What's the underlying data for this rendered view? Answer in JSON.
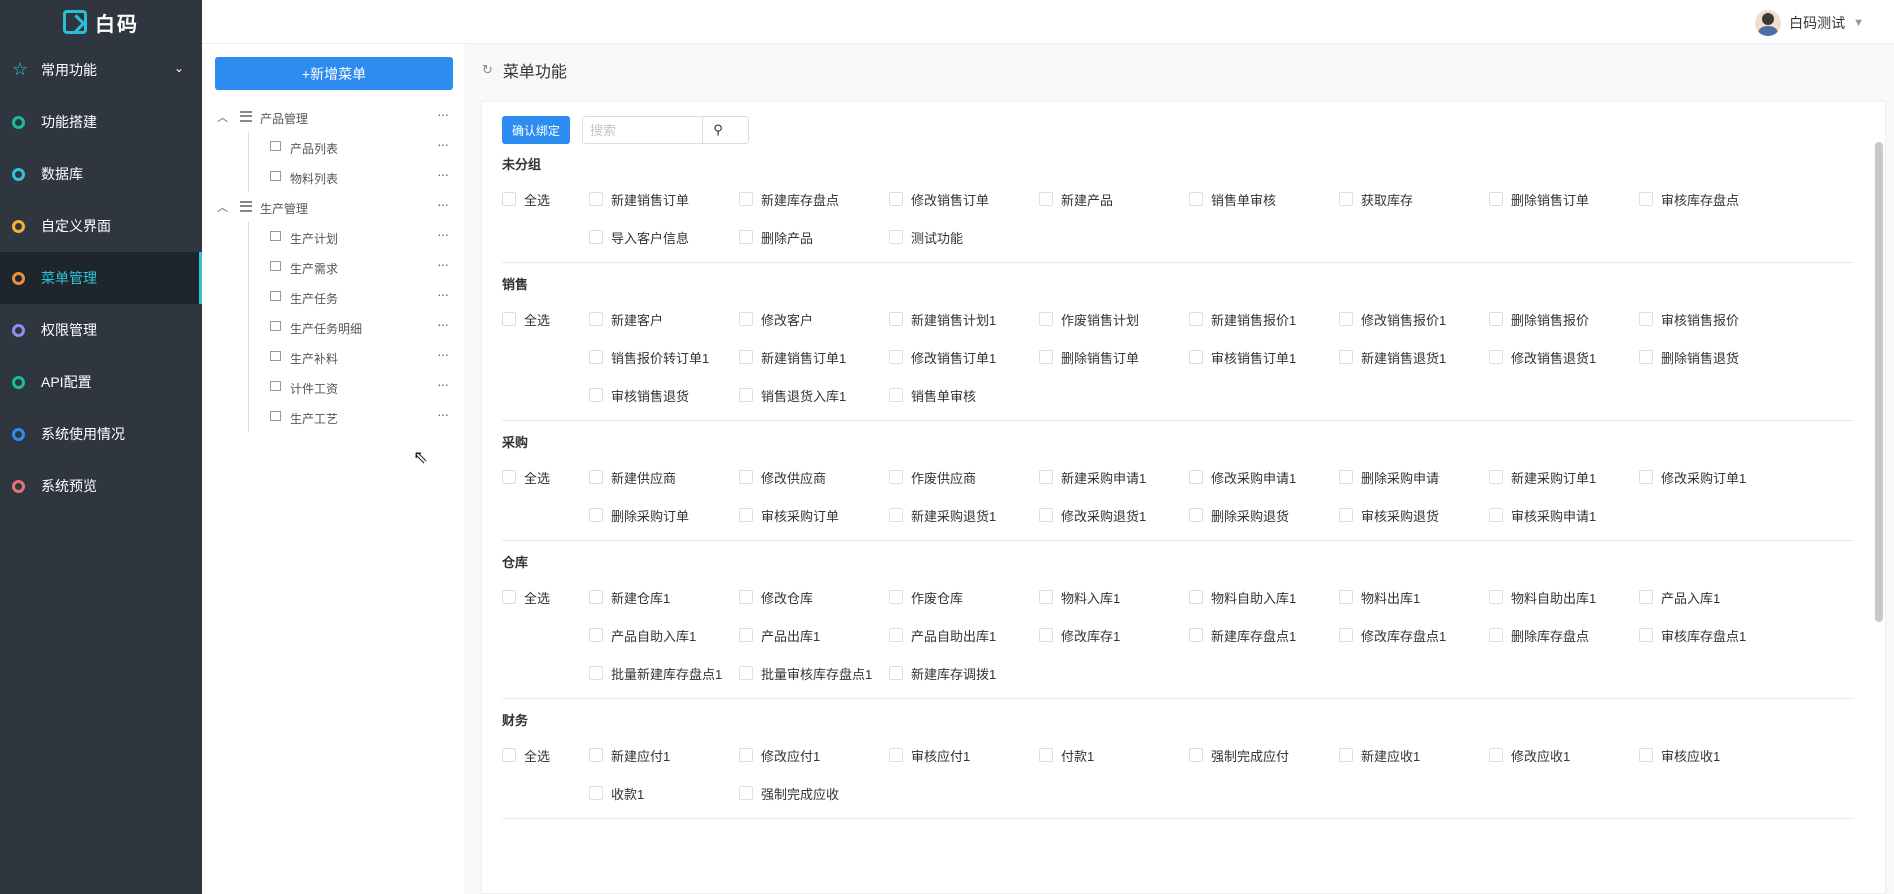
{
  "app": {
    "logo_text": "白码"
  },
  "header": {
    "user_name": "白码测试"
  },
  "sidebar": {
    "items": [
      {
        "label": "常用功能",
        "icon": "star-icon",
        "color": "#2ec4d6",
        "active": false,
        "has_chevron": true
      },
      {
        "label": "功能搭建",
        "icon": "circle-icon",
        "color": "#1abc9c",
        "active": false
      },
      {
        "label": "数据库",
        "icon": "circle-icon",
        "color": "#2ec4d6",
        "active": false
      },
      {
        "label": "自定义界面",
        "icon": "circle-icon",
        "color": "#f5b335",
        "active": false
      },
      {
        "label": "菜单管理",
        "icon": "circle-icon",
        "color": "#e8913a",
        "active": true
      },
      {
        "label": "权限管理",
        "icon": "circle-icon",
        "color": "#8e8ef0",
        "active": false
      },
      {
        "label": "API配置",
        "icon": "circle-icon",
        "color": "#1abc9c",
        "active": false
      },
      {
        "label": "系统使用情况",
        "icon": "circle-icon",
        "color": "#2d8cf0",
        "active": false
      },
      {
        "label": "系统预览",
        "icon": "circle-icon",
        "color": "#e57373",
        "active": false
      }
    ]
  },
  "tree_panel": {
    "add_button": "+新增菜单",
    "groups": [
      {
        "label": "产品管理",
        "children": [
          "产品列表",
          "物料列表"
        ]
      },
      {
        "label": "生产管理",
        "children": [
          "生产计划",
          "生产需求",
          "生产任务",
          "生产任务明细",
          "生产补料",
          "计件工资",
          "生产工艺"
        ]
      }
    ]
  },
  "main": {
    "title": "菜单功能",
    "confirm_button": "确认绑定",
    "search_placeholder": "搜索",
    "select_all_label": "全选",
    "groups": [
      {
        "title": "未分组",
        "items": [
          "新建销售订单",
          "新建库存盘点",
          "修改销售订单",
          "新建产品",
          "销售单审核",
          "获取库存",
          "删除销售订单",
          "审核库存盘点",
          "导入客户信息",
          "删除产品",
          "测试功能"
        ]
      },
      {
        "title": "销售",
        "items": [
          "新建客户",
          "修改客户",
          "新建销售计划1",
          "作废销售计划",
          "新建销售报价1",
          "修改销售报价1",
          "删除销售报价",
          "审核销售报价",
          "销售报价转订单1",
          "新建销售订单1",
          "修改销售订单1",
          "删除销售订单",
          "审核销售订单1",
          "新建销售退货1",
          "修改销售退货1",
          "删除销售退货",
          "审核销售退货",
          "销售退货入库1",
          "销售单审核"
        ]
      },
      {
        "title": "采购",
        "items": [
          "新建供应商",
          "修改供应商",
          "作废供应商",
          "新建采购申请1",
          "修改采购申请1",
          "删除采购申请",
          "新建采购订单1",
          "修改采购订单1",
          "删除采购订单",
          "审核采购订单",
          "新建采购退货1",
          "修改采购退货1",
          "删除采购退货",
          "审核采购退货",
          "审核采购申请1"
        ]
      },
      {
        "title": "仓库",
        "items": [
          "新建仓库1",
          "修改仓库",
          "作废仓库",
          "物料入库1",
          "物料自助入库1",
          "物料出库1",
          "物料自助出库1",
          "产品入库1",
          "产品自助入库1",
          "产品出库1",
          "产品自助出库1",
          "修改库存1",
          "新建库存盘点1",
          "修改库存盘点1",
          "删除库存盘点",
          "审核库存盘点1",
          "批量新建库存盘点1",
          "批量审核库存盘点1",
          "新建库存调拨1"
        ]
      },
      {
        "title": "财务",
        "items": [
          "新建应付1",
          "修改应付1",
          "审核应付1",
          "付款1",
          "强制完成应付",
          "新建应收1",
          "修改应收1",
          "审核应收1",
          "收款1",
          "强制完成应收"
        ]
      }
    ]
  }
}
